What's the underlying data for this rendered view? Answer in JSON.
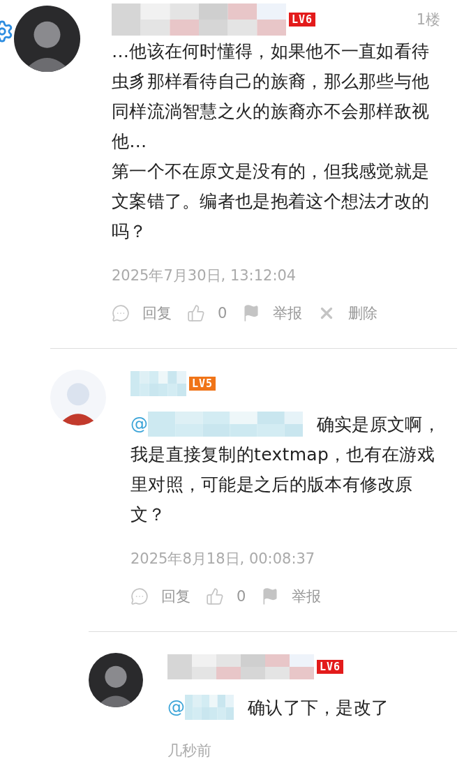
{
  "comments": [
    {
      "avatar": {
        "kind": "dark"
      },
      "badge": {
        "text": "LV6",
        "color": "#e31b1b"
      },
      "floor": "1楼",
      "paragraphs": [
        "…他该在何时懂得，如果他不一直如看待虫豸那样看待自己的族裔，那么那些与他同样流淌智慧之火的族裔亦不会那样敌视他…",
        "第一个不在原文是没有的，但我感觉就是文案错了。编者也是抱着这个想法才改的吗？"
      ],
      "time": "2025年7月30日, 13:12:04",
      "actions": [
        {
          "kind": "reply",
          "label": "回复"
        },
        {
          "kind": "like",
          "label": "0"
        },
        {
          "kind": "report",
          "label": "举报"
        },
        {
          "kind": "delete",
          "label": "删除"
        }
      ],
      "children": [
        {
          "avatar": {
            "kind": "light"
          },
          "badge": {
            "text": "LV5",
            "color": "#f07418"
          },
          "mention": "@",
          "paragraphs": [
            "确实是原文啊，",
            "我是直接复制的textmap，也有在游戏里对照，可能是之后的版本有修改原文？"
          ],
          "time": "2025年8月18日, 00:08:37",
          "actions": [
            {
              "kind": "reply",
              "label": "回复"
            },
            {
              "kind": "like",
              "label": "0"
            },
            {
              "kind": "report",
              "label": "举报"
            }
          ],
          "children": [
            {
              "avatar": {
                "kind": "dark"
              },
              "badge": {
                "text": "LV6",
                "color": "#e31b1b"
              },
              "mention": "@",
              "paragraphs": [
                "确认了下，是改了"
              ],
              "time": "几秒前"
            }
          ]
        }
      ]
    }
  ]
}
